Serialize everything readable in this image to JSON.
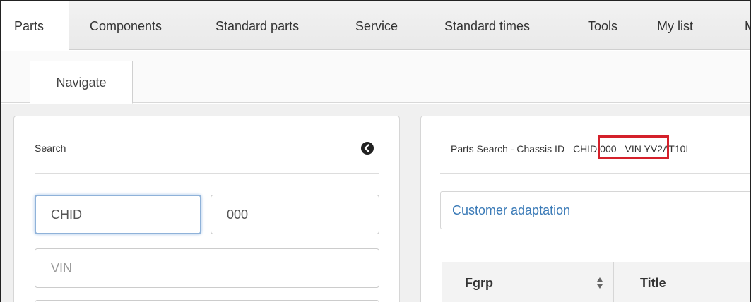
{
  "top_tabs": [
    {
      "label": "Parts",
      "active": true
    },
    {
      "label": "Components"
    },
    {
      "label": "Standard parts"
    },
    {
      "label": "Service"
    },
    {
      "label": "Standard times"
    },
    {
      "label": "Tools"
    },
    {
      "label": "My list"
    },
    {
      "label": "M"
    }
  ],
  "sub_tabs": [
    {
      "label": "Navigate",
      "active": true
    }
  ],
  "search_panel": {
    "title": "Search",
    "back_icon": "circle-chevron-left-icon",
    "chassis_series_value": "CHID",
    "chassis_number_value": "000",
    "vin_placeholder": "VIN"
  },
  "results_panel": {
    "title_prefix": "Parts Search - Chassis ID",
    "title_chassis": "CHID 000",
    "title_suffix": "VIN YV2AT10I",
    "customer_adaptation": "Customer adaptation",
    "table_columns": [
      "Fgrp",
      "Title"
    ],
    "sort_icon": "sort-icon"
  },
  "colors": {
    "highlight": "#d4202a",
    "link": "#3a7ab7",
    "focus_border": "#8fb2d9"
  }
}
